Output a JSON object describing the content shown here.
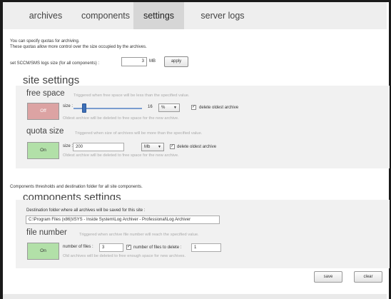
{
  "tabs": [
    {
      "label": "archives"
    },
    {
      "label": "components"
    },
    {
      "label": "settings"
    },
    {
      "label": "server logs"
    }
  ],
  "active_tab": "settings",
  "intro": {
    "line1": "You can specify quotas for archiving.",
    "line2": "These quotas allow more control over the size occupied by the archives."
  },
  "sccm": {
    "label": "set SCCM/SMS logs size (for all components) :",
    "value": "3",
    "unit": "MB",
    "apply_label": "apply"
  },
  "site_settings": {
    "title": "site settings",
    "free_space": {
      "title": "free space",
      "hint": "Triggered when free space will be less than the specified value.",
      "toggle": "Off",
      "size_label": "size :",
      "slider_value": 16,
      "unit": "%",
      "delete_label": "delete oldest archive",
      "delete_checked": true,
      "note": "Oldest archive will be deleted to free space for the new archive."
    },
    "quota_size": {
      "title": "quota size",
      "hint": "Triggered when size of archives will be more than the specified value.",
      "toggle": "On",
      "size_label": "size :",
      "size_value": "200",
      "unit": "Mb",
      "delete_label": "delete oldest archive",
      "delete_checked": true,
      "note": "Oldest archive will be deleted to free space for the new archive."
    }
  },
  "components_intro": "Components thresholds and destination folder for all site components.",
  "components_settings": {
    "title": "components settings",
    "dest_label": "Destination folder where all archives will be saved for this site :",
    "dest_value": "C:\\Program Files (x86)\\ISYS - Inside System\\Log Archiver - Professional\\Log Archiver",
    "file_number": {
      "title": "file number",
      "hint": "Triggered when archive file number will reach the specified value.",
      "toggle": "On",
      "files_label": "number of files :",
      "files_value": "3",
      "delete_label": "number of files to delete :",
      "delete_value": "1",
      "delete_checked": true,
      "note": "Old archives will be deleted to free enough space for new archives."
    }
  },
  "footer": {
    "save_label": "save",
    "clear_label": "clear"
  },
  "colors": {
    "toggle_off": "#dca3a3",
    "toggle_on": "#b2e0a8",
    "slider": "#3d6fb8"
  }
}
